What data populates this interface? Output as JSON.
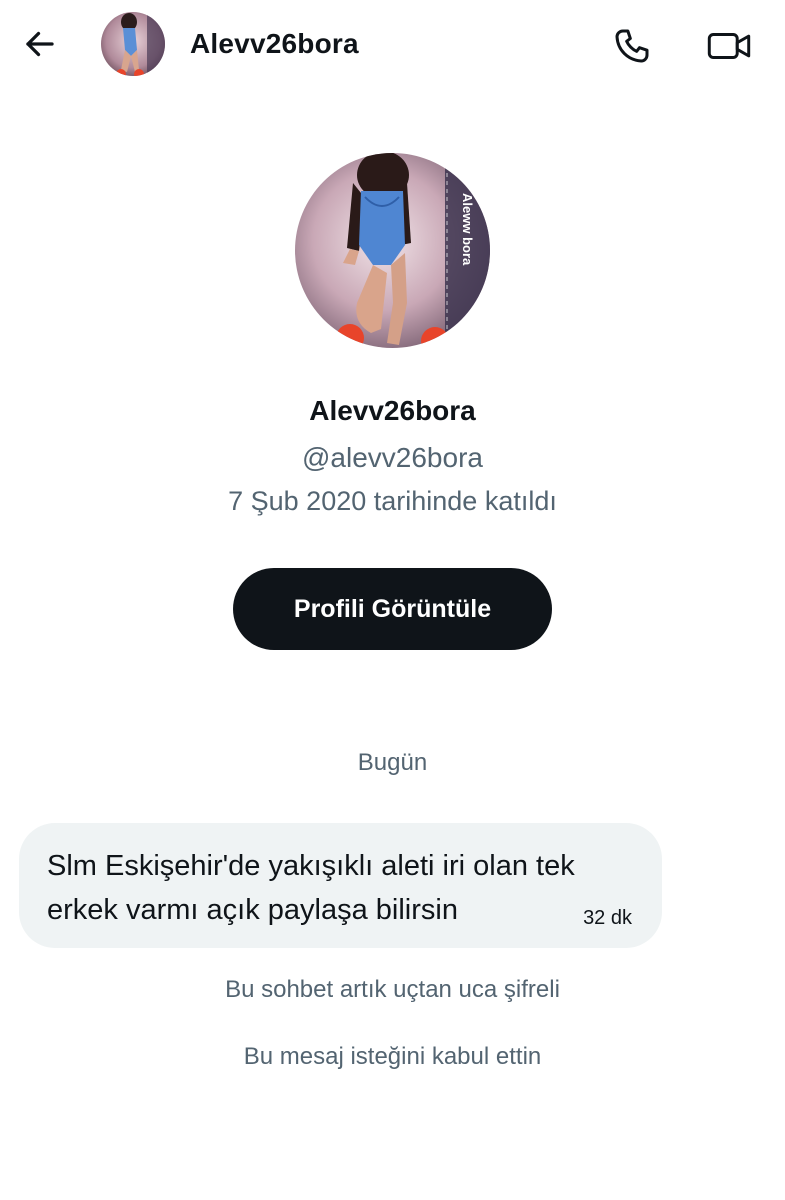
{
  "header": {
    "username": "Alevv26bora",
    "back_icon": "arrow-left-icon",
    "call_icon": "phone-icon",
    "video_icon": "video-camera-icon"
  },
  "profile": {
    "display_name": "Alevv26bora",
    "handle": "@alevv26bora",
    "joined": "7 Şub 2020 tarihinde katıldı",
    "view_button_label": "Profili Görüntüle",
    "avatar_watermark": "Aleww bora"
  },
  "conversation": {
    "date_separator": "Bugün",
    "messages": [
      {
        "text": "Slm Eskişehir'de yakışıklı aleti iri olan tek erkek varmı açık paylaşa bilirsin",
        "time": "32 dk"
      }
    ],
    "system_notes": [
      "Bu sohbet artık uçtan uca şifreli",
      "Bu mesaj isteğini kabul ettin"
    ]
  },
  "colors": {
    "primary_text": "#0f1419",
    "secondary_text": "#536471",
    "bubble_bg": "#eff3f4",
    "button_bg": "#0f1419"
  }
}
